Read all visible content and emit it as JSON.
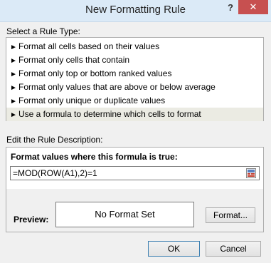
{
  "window": {
    "title": "New Formatting Rule",
    "help_label": "?",
    "close_label": "✕"
  },
  "rule_type": {
    "label": "Select a Rule Type:",
    "items": [
      {
        "arrow": "►",
        "label": "Format all cells based on their values"
      },
      {
        "arrow": "►",
        "label": "Format only cells that contain"
      },
      {
        "arrow": "►",
        "label": "Format only top or bottom ranked values"
      },
      {
        "arrow": "►",
        "label": "Format only values that are above or below average"
      },
      {
        "arrow": "►",
        "label": "Format only unique or duplicate values"
      },
      {
        "arrow": "►",
        "label": "Use a formula to determine which cells to format"
      }
    ],
    "selected_index": 5
  },
  "description": {
    "label": "Edit the Rule Description:",
    "formula_heading": "Format values where this formula is true:",
    "formula_value": "=MOD(ROW(A1),2)=1",
    "preview_label": "Preview:",
    "preview_text": "No Format Set",
    "format_button": "Format..."
  },
  "footer": {
    "ok_label": "OK",
    "cancel_label": "Cancel"
  },
  "icons": {
    "collapse": "range-selector-icon"
  },
  "colors": {
    "titlebar": "#dbeaf7",
    "close_button": "#c75050",
    "selected_item": "#ebebe3"
  }
}
